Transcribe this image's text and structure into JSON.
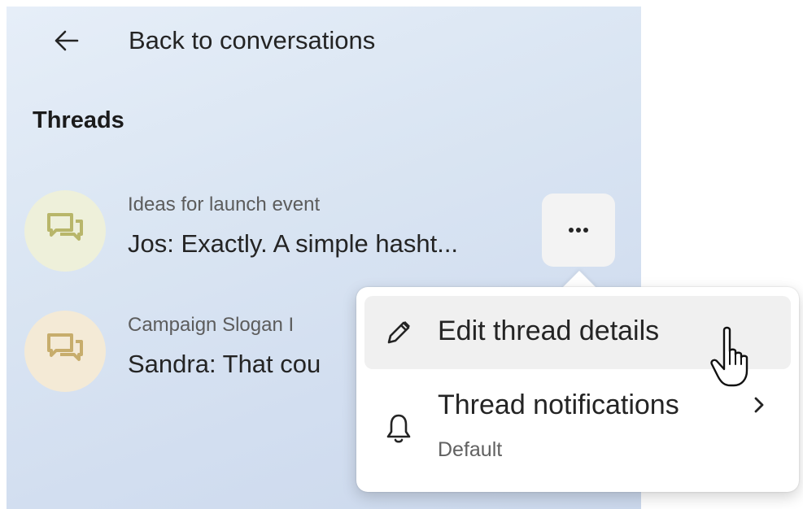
{
  "back": {
    "label": "Back to conversations",
    "icon": "arrow-left-icon"
  },
  "section": {
    "title": "Threads"
  },
  "threads": [
    {
      "title": "Ideas for launch event",
      "preview": "Jos: Exactly. A simple hasht...",
      "icon": "chat-bubbles-icon",
      "avatar_color": "#eef0da"
    },
    {
      "title": "Campaign Slogan I",
      "preview": "Sandra: That cou",
      "icon": "chat-bubbles-icon",
      "avatar_color": "#f4ead6"
    }
  ],
  "more_button": {
    "icon": "more-horizontal-icon"
  },
  "context_menu": {
    "items": [
      {
        "label": "Edit thread details",
        "icon": "pencil-icon"
      },
      {
        "label": "Thread notifications",
        "sub": "Default",
        "icon": "bell-icon",
        "trailing_icon": "chevron-right-icon"
      }
    ]
  },
  "colors": {
    "panel_bg": "#d2def0",
    "text_primary": "#242424",
    "text_secondary": "#5c5c5c",
    "menu_hover": "#f0f0f0",
    "chat_icon_green": "#b8b66a",
    "chat_icon_tan": "#c7ad6c"
  }
}
